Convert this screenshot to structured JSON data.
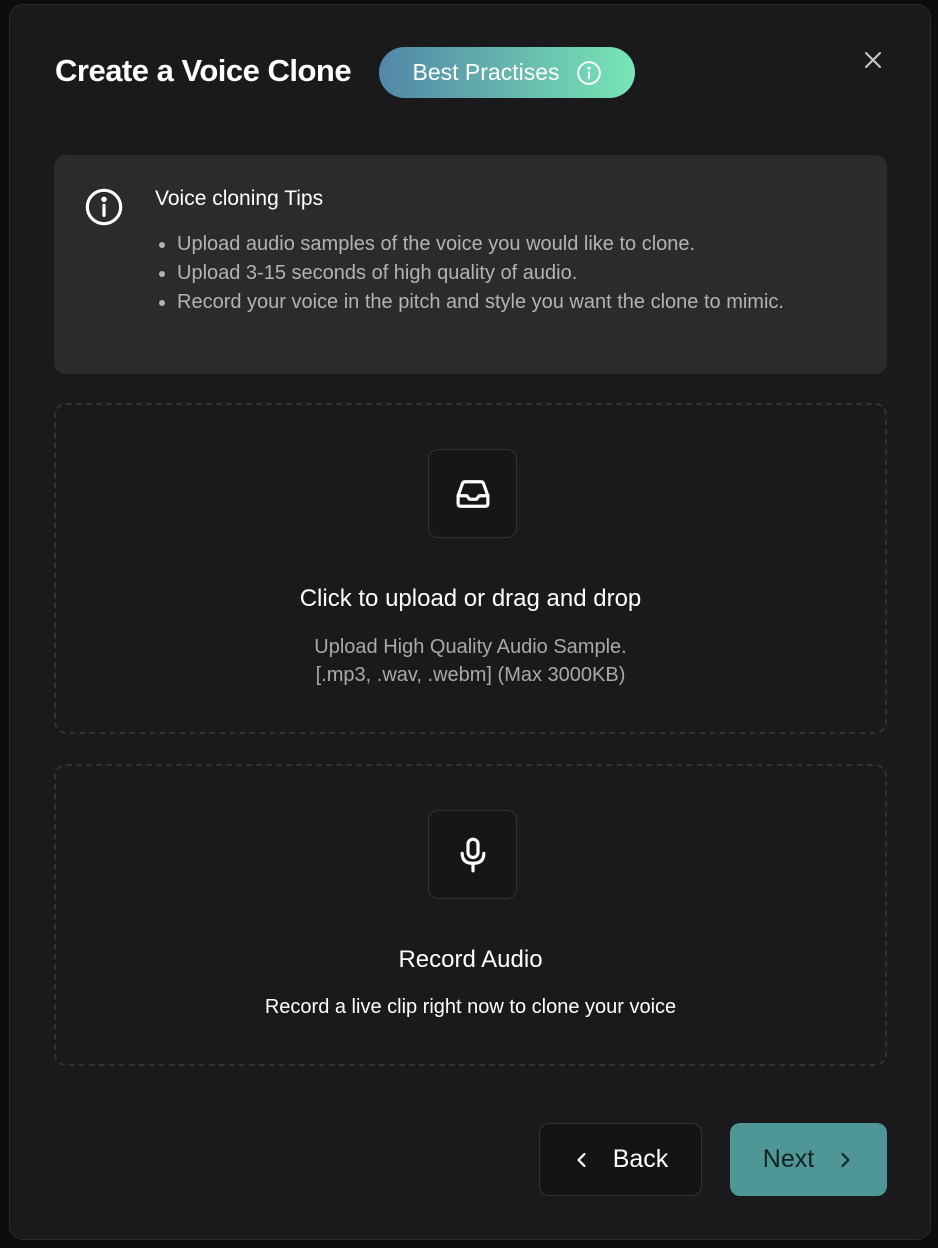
{
  "dialog": {
    "title": "Create a Voice Clone",
    "best_practises_label": "Best Practises"
  },
  "tips": {
    "title": "Voice cloning Tips",
    "items": [
      "Upload audio samples of the voice you would like to clone.",
      "Upload 3-15 seconds of high quality of audio.",
      "Record your voice in the pitch and style you want the clone to mimic."
    ]
  },
  "upload": {
    "title": "Click to upload or drag and drop",
    "subtitle": "Upload High Quality Audio Sample.",
    "formats": "[.mp3, .wav, .webm] (Max 3000KB)",
    "icon": "inbox-icon"
  },
  "record": {
    "title": "Record Audio",
    "subtitle": "Record a live clip right now to clone your voice",
    "icon": "microphone-icon"
  },
  "footer": {
    "back_label": "Back",
    "next_label": "Next"
  },
  "colors": {
    "background": "#1a1a1c",
    "tips_background": "#2b2b2d",
    "next_button": "#4f9797",
    "pill_gradient_start": "#5187a8",
    "pill_gradient_end": "#77e6b6"
  }
}
